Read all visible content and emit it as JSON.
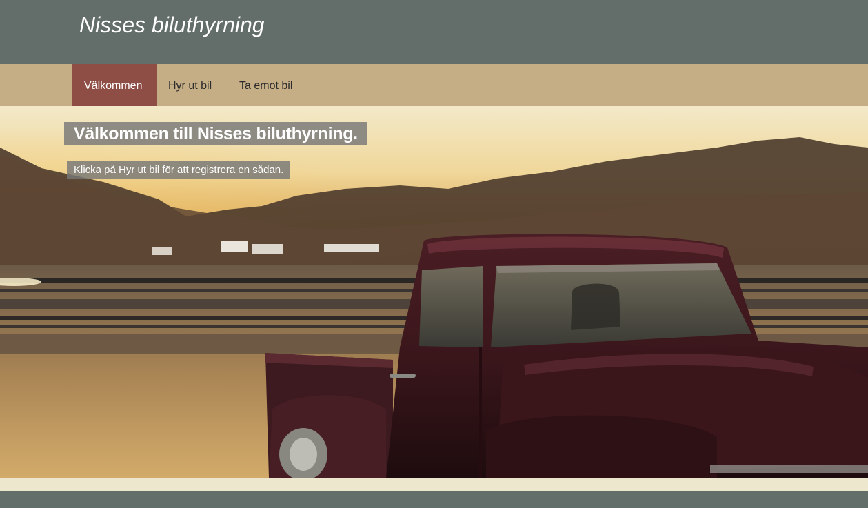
{
  "header": {
    "site_title": "Nisses biluthyrning"
  },
  "nav": {
    "items": [
      {
        "label": "Välkommen",
        "active": true
      },
      {
        "label": "Hyr ut bil",
        "active": false
      },
      {
        "label": "Ta emot bil",
        "active": false
      }
    ]
  },
  "hero": {
    "heading": "Välkommen till Nisses biluthyrning.",
    "subtext": "Klicka på Hyr ut bil för att registrera en sådan.",
    "image_subject": "vintage-pickup-truck-photo"
  },
  "colors": {
    "header_bg": "#636d6a",
    "nav_bg": "#c5ad86",
    "nav_active_bg": "#8e4e45",
    "footer_light": "#ece7cd"
  }
}
